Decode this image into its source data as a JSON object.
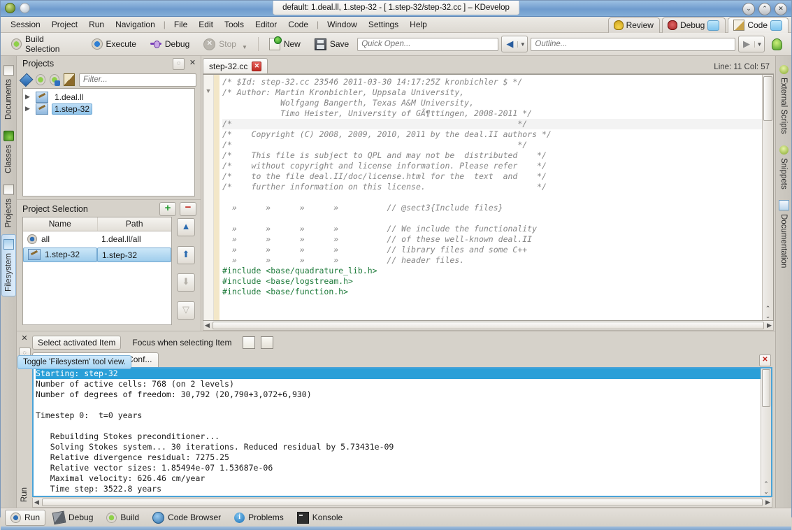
{
  "window": {
    "title": "default:  1.deal.ll, 1.step-32 - [ 1.step-32/step-32.cc ] – KDevelop",
    "minimize": "⌄",
    "maximize": "⌃",
    "close": "✕"
  },
  "menubar": {
    "items": [
      "Session",
      "Project",
      "Run",
      "Navigation",
      "|",
      "File",
      "Edit",
      "Tools",
      "Editor",
      "Code",
      "|",
      "Window",
      "Settings",
      "Help"
    ],
    "modes": [
      {
        "label": "Review",
        "icon": "hardhat-icon",
        "active": false
      },
      {
        "label": "Debug",
        "icon": "bug-icon",
        "active": false
      },
      {
        "label": "Code",
        "icon": "pencil-icon",
        "active": true
      }
    ]
  },
  "toolbar": {
    "build_selection": "Build Selection",
    "execute": "Execute",
    "debug": "Debug",
    "stop": "Stop",
    "new": "New",
    "save": "Save",
    "quick_open_placeholder": "Quick Open...",
    "outline_placeholder": "Outline..."
  },
  "left_sidebar": {
    "tabs": [
      {
        "label": "Documents",
        "icon": "documents-icon",
        "active": false
      },
      {
        "label": "Classes",
        "icon": "classes-icon",
        "active": false
      },
      {
        "label": "Projects",
        "icon": "projects-icon",
        "active": false
      },
      {
        "label": "Filesystem",
        "icon": "filesystem-icon",
        "active": true
      }
    ]
  },
  "right_sidebar": {
    "tabs": [
      {
        "label": "External Scripts",
        "icon": "external-scripts-icon"
      },
      {
        "label": "Snippets",
        "icon": "snippets-icon"
      },
      {
        "label": "Documentation",
        "icon": "documentation-icon"
      }
    ]
  },
  "projects_dock": {
    "title": "Projects",
    "config_btn": "◌",
    "close_btn": "✕",
    "filter_placeholder": "Filter...",
    "tree": [
      {
        "label": "1.deal.ll",
        "selected": false
      },
      {
        "label": "1.step-32",
        "selected": true
      }
    ]
  },
  "project_selection": {
    "title": "Project Selection",
    "add_label": "+",
    "remove_label": "−",
    "columns": [
      "Name",
      "Path"
    ],
    "rows": [
      {
        "name": "all",
        "path": "1.deal.ll/all",
        "icon": "gear-icon",
        "selected": false
      },
      {
        "name": "1.step-32",
        "path": "1.step-32",
        "icon": "project-icon",
        "selected": true
      }
    ],
    "side_buttons": [
      "▲",
      "⬆",
      "⬇",
      "▽"
    ]
  },
  "tooltip": {
    "text": "Toggle 'Filesystem' tool view."
  },
  "editor": {
    "tab_label": "step-32.cc",
    "tab_close": "✕",
    "position": "Line: 11 Col: 57",
    "lines": [
      {
        "text": "/* $Id: step-32.cc 23546 2011-03-30 14:17:25Z kronbichler $ */",
        "cls": "cmt",
        "hl": false
      },
      {
        "text": "/* Author: Martin Kronbichler, Uppsala University,",
        "cls": "cmt",
        "hl": false
      },
      {
        "text": "            Wolfgang Bangerth, Texas A&M University,",
        "cls": "cmt",
        "hl": false
      },
      {
        "text": "            Timo Heister, University of GÃ¶ttingen, 2008-2011 */",
        "cls": "cmt",
        "hl": false
      },
      {
        "text": "/*                                                           */",
        "cls": "cmt",
        "hl": true
      },
      {
        "text": "/*    Copyright (C) 2008, 2009, 2010, 2011 by the deal.II authors */",
        "cls": "cmt",
        "hl": false
      },
      {
        "text": "/*                                                           */",
        "cls": "cmt",
        "hl": false
      },
      {
        "text": "/*    This file is subject to QPL and may not be  distributed    */",
        "cls": "cmt",
        "hl": false
      },
      {
        "text": "/*    without copyright and license information. Please refer    */",
        "cls": "cmt",
        "hl": false
      },
      {
        "text": "/*    to the file deal.II/doc/license.html for the  text  and    */",
        "cls": "cmt",
        "hl": false
      },
      {
        "text": "/*    further information on this license.                       */",
        "cls": "cmt",
        "hl": false
      },
      {
        "text": "",
        "cls": "cmt",
        "hl": false
      },
      {
        "text": "  »      »      »      »          // @sect3{Include files}",
        "cls": "cmt",
        "hl": false
      },
      {
        "text": "",
        "cls": "cmt",
        "hl": false
      },
      {
        "text": "  »      »      »      »          // We include the functionality",
        "cls": "cmt",
        "hl": false
      },
      {
        "text": "  »      »      »      »          // of these well-known deal.II",
        "cls": "cmt",
        "hl": false
      },
      {
        "text": "  »      »      »      »          // library files and some C++",
        "cls": "cmt",
        "hl": false
      },
      {
        "text": "  »      »      »      »          // header files.",
        "cls": "cmt",
        "hl": false
      },
      {
        "text": "#include <base/quadrature_lib.h>",
        "cls": "inc",
        "hl": false
      },
      {
        "text": "#include <base/logstream.h>",
        "cls": "inc",
        "hl": false
      },
      {
        "text": "#include <base/function.h>",
        "cls": "inc",
        "hl": false
      }
    ]
  },
  "bottom_dock": {
    "close_btn": "✕",
    "config_btn": "◌",
    "run_label": "Run",
    "select_activated": "Select activated Item",
    "focus_when_selecting": "Focus when selecting Item",
    "tab_label": "New Native Application Conf...",
    "tab_close": "✕",
    "output_lines": [
      {
        "text": "Starting: step-32",
        "first": true
      },
      {
        "text": "Number of active cells: 768 (on 2 levels)",
        "first": false
      },
      {
        "text": "Number of degrees of freedom: 30,792 (20,790+3,072+6,930)",
        "first": false
      },
      {
        "text": "",
        "first": false
      },
      {
        "text": "Timestep 0:  t=0 years",
        "first": false
      },
      {
        "text": "",
        "first": false
      },
      {
        "text": "   Rebuilding Stokes preconditioner...",
        "first": false
      },
      {
        "text": "   Solving Stokes system... 30 iterations. Reduced residual by 5.73431e-09",
        "first": false
      },
      {
        "text": "   Relative divergence residual: 7275.25",
        "first": false
      },
      {
        "text": "   Relative vector sizes: 1.85494e-07 1.53687e-06",
        "first": false
      },
      {
        "text": "   Maximal velocity: 626.46 cm/year",
        "first": false
      },
      {
        "text": "   Time step: 3522.8 years",
        "first": false
      }
    ]
  },
  "statusbar": {
    "items": [
      {
        "label": "Run",
        "icon": "run-icon",
        "active": true
      },
      {
        "label": "Debug",
        "icon": "debug-icon",
        "active": false
      },
      {
        "label": "Build",
        "icon": "build-icon",
        "active": false
      },
      {
        "label": "Code Browser",
        "icon": "code-browser-icon",
        "active": false
      },
      {
        "label": "Problems",
        "icon": "problems-icon",
        "active": false
      },
      {
        "label": "Konsole",
        "icon": "konsole-icon",
        "active": false
      }
    ]
  }
}
